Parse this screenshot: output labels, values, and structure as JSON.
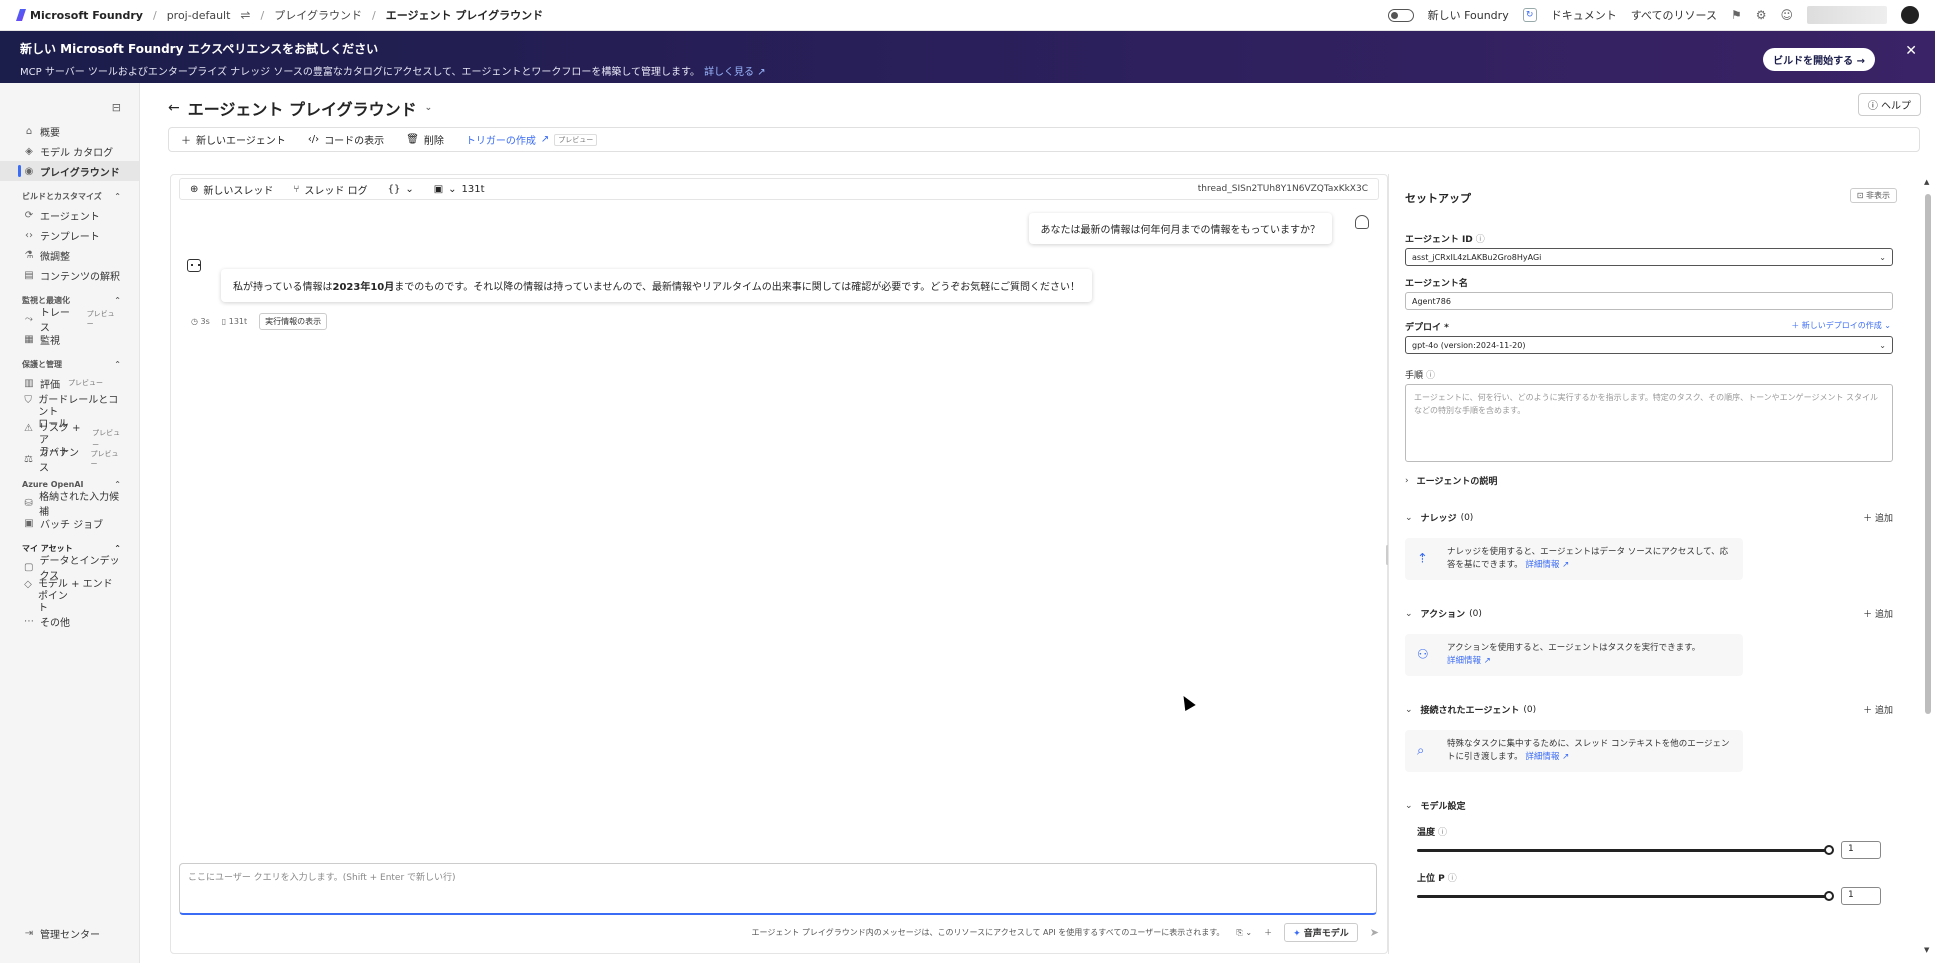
{
  "topbar": {
    "brand": "Microsoft Foundry",
    "project": "proj-default",
    "crumb_playground": "プレイグラウンド",
    "crumb_current": "エージェント プレイグラウンド",
    "toggle_label": "新しい Foundry",
    "docs": "ドキュメント",
    "all_resources": "すべてのリソース"
  },
  "banner": {
    "title": "新しい Microsoft Foundry エクスペリエンスをお試しください",
    "desc": "MCP サーバー ツールおよびエンタープライズ ナレッジ ソースの豊富なカタログにアクセスして、エージェントとワークフローを構築して管理します。",
    "link": "詳しく見る",
    "cta": "ビルドを開始する →",
    "bg_color": "#1b1d4a"
  },
  "sidebar": {
    "overview": "概要",
    "model_catalog": "モデル カタログ",
    "playground": "プレイグラウンド",
    "sec_build": "ビルドとカスタマイズ",
    "agents": "エージェント",
    "templates": "テンプレート",
    "fine_tuning": "微調整",
    "content_understanding": "コンテンツの解釈",
    "sec_observe": "監視と最適化",
    "tracing": "トレース",
    "tracing_badge": "プレビュー",
    "monitoring": "監視",
    "sec_protect": "保護と管理",
    "evaluation": "評価",
    "evaluation_badge": "プレビュー",
    "guardrails_1": "ガードレールとコント",
    "guardrails_2": "ロール",
    "risk_1": "リスク + ア",
    "risk_2": "ラート",
    "risk_badge": "プレビュー",
    "governance": "ガバナンス",
    "governance_badge": "プレビュー",
    "sec_azure": "Azure OpenAI",
    "stored_completions": "格納された入力候補",
    "batch_jobs": "バッチ ジョブ",
    "sec_assets": "マイ アセット",
    "data_indexes": "データとインデックス",
    "models_endpoints_1": "モデル + エンドポイン",
    "models_endpoints_2": "ト",
    "more": "その他",
    "admin_center": "管理センター"
  },
  "main": {
    "title": "エージェント プレイグラウンド",
    "help": "ヘルプ",
    "toolbar": {
      "new_agent": "新しいエージェント",
      "view_code": "コードの表示",
      "delete": "削除",
      "create_trigger": "トリガーの作成",
      "preview": "プレビュー"
    }
  },
  "chat": {
    "new_thread": "新しいスレッド",
    "thread_log": "スレッド ログ",
    "tokens": "131t",
    "thread_id": "thread_SISn2TUh8Y1N6VZQTaxKkX3C",
    "user_message": "あなたは最新の情報は何年何月までの情報をもっていますか？",
    "bot_pre": "私が持っている情報は",
    "bot_bold": "2023年10月",
    "bot_post": "までのものです。それ以降の情報は持っていませんので、最新情報やリアルタイムの出来事に関しては確認が必要です。どうぞお気軽にご質問ください！",
    "meta_time": "3s",
    "meta_tokens": "131t",
    "meta_run_info": "実行情報の表示",
    "input_placeholder": "ここにユーザー クエリを入力します。(Shift + Enter で新しい行)",
    "footer_note": "エージェント プレイグラウンド内のメッセージは、このリソースにアクセスして API を使用するすべてのユーザーに表示されます。",
    "voice_model": "音声モデル"
  },
  "setup": {
    "title": "セットアップ",
    "hide": "非表示",
    "agent_id_label": "エージェント ID",
    "agent_id_value": "asst_jCRxIL4zLAKBu2Gro8HyAGi",
    "agent_name_label": "エージェント名",
    "agent_name_value": "Agent786",
    "deploy_label": "デプロイ *",
    "new_deploy": "＋ 新しいデプロイの作成 ⌄",
    "deploy_value": "gpt-4o (version:2024-11-20)",
    "instructions_label": "手順",
    "instructions_placeholder": "エージェントに、何を行い、どのように実行するかを指示します。特定のタスク、その順序、トーンやエンゲージメント スタイルなどの特別な手順を含めます。",
    "agent_description": "エージェントの説明",
    "knowledge": "ナレッジ",
    "knowledge_count": "(0)",
    "knowledge_text": "ナレッジを使用すると、エージェントはデータ ソースにアクセスして、応答を基にできます。",
    "actions": "アクション",
    "actions_count": "(0)",
    "actions_text": "アクションを使用すると、エージェントはタスクを実行できます。",
    "connected_agents": "接続されたエージェント",
    "connected_count": "(0)",
    "connected_text": "特殊なタスクに集中するために、スレッド コンテキストを他のエージェントに引き渡します。",
    "learn_more": "詳細情報",
    "add": "＋ 追加",
    "model_settings": "モデル設定",
    "temperature": "温度",
    "temperature_value": "1",
    "top_p": "上位 P",
    "top_p_value": "1",
    "accent_color": "#3b6cf6"
  }
}
